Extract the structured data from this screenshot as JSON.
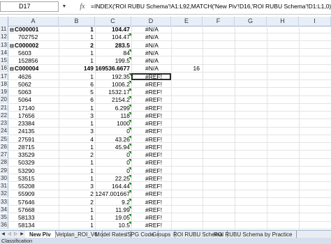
{
  "formula_bar": {
    "name_box": "D17",
    "fx_label": "fx",
    "formula": "=INDEX('ROI RUBU Schema'!A1:L92,MATCH('New Piv'!D16,'ROI RUBU Schema'!D1:L1,0))"
  },
  "columns": [
    "A",
    "B",
    "C",
    "D",
    "E",
    "F",
    "G",
    "H",
    "I"
  ],
  "rows": [
    {
      "num": "11",
      "a": "C000001",
      "b": "1",
      "c": "104.47",
      "d": "#N/A",
      "bold": true,
      "expander": true
    },
    {
      "num": "12",
      "a": "702752",
      "b": "1",
      "c": "104.47",
      "d": "#N/A"
    },
    {
      "num": "13",
      "a": "C000002",
      "b": "2",
      "c": "283.5",
      "d": "#N/A",
      "bold": true,
      "expander": true
    },
    {
      "num": "14",
      "a": "5603",
      "b": "1",
      "c": "84",
      "d": "#N/A"
    },
    {
      "num": "15",
      "a": "152856",
      "b": "1",
      "c": "199.5",
      "d": "#N/A"
    },
    {
      "num": "16",
      "a": "C000004",
      "b": "149",
      "c": "169536.6677",
      "d": "#N/A",
      "e": "16",
      "bold": true,
      "expander": true
    },
    {
      "num": "17",
      "a": "4626",
      "b": "1",
      "c": "192.35",
      "d": "#REF!",
      "selected": true
    },
    {
      "num": "18",
      "a": "5062",
      "b": "6",
      "c": "1006.2",
      "d": "#REF!"
    },
    {
      "num": "19",
      "a": "5063",
      "b": "5",
      "c": "1532.17",
      "d": "#REF!"
    },
    {
      "num": "20",
      "a": "5064",
      "b": "6",
      "c": "2154.2",
      "d": "#REF!"
    },
    {
      "num": "21",
      "a": "17140",
      "b": "1",
      "c": "6.299",
      "d": "#REF!"
    },
    {
      "num": "22",
      "a": "17656",
      "b": "3",
      "c": "118",
      "d": "#REF!"
    },
    {
      "num": "23",
      "a": "23384",
      "b": "1",
      "c": "1000",
      "d": "#REF!"
    },
    {
      "num": "24",
      "a": "24135",
      "b": "3",
      "c": "0",
      "d": "#REF!"
    },
    {
      "num": "25",
      "a": "27591",
      "b": "4",
      "c": "43.26",
      "d": "#REF!"
    },
    {
      "num": "26",
      "a": "28715",
      "b": "1",
      "c": "45.94",
      "d": "#REF!"
    },
    {
      "num": "27",
      "a": "33529",
      "b": "2",
      "c": "0",
      "d": "#REF!"
    },
    {
      "num": "28",
      "a": "50329",
      "b": "1",
      "c": "0",
      "d": "#REF!"
    },
    {
      "num": "29",
      "a": "53290",
      "b": "1",
      "c": "0",
      "d": "#REF!"
    },
    {
      "num": "30",
      "a": "53515",
      "b": "1",
      "c": "22.25",
      "d": "#REF!"
    },
    {
      "num": "31",
      "a": "55208",
      "b": "3",
      "c": "164.44",
      "d": "#REF!"
    },
    {
      "num": "32",
      "a": "55909",
      "b": "2",
      "c": "1247.001667",
      "d": "#REF!"
    },
    {
      "num": "33",
      "a": "57646",
      "b": "2",
      "c": "9.2",
      "d": "#REF!"
    },
    {
      "num": "34",
      "a": "57668",
      "b": "1",
      "c": "11.99",
      "d": "#REF!"
    },
    {
      "num": "35",
      "a": "58133",
      "b": "1",
      "c": "19.05",
      "d": "#REF!"
    },
    {
      "num": "36",
      "a": "58134",
      "b": "1",
      "c": "10.5",
      "d": "#REF!"
    }
  ],
  "sheet_tabs": [
    "New Piv",
    "Vetplan_ROI_V6",
    "Model Rates",
    "ISPG Code",
    "Groups",
    "ROI RUBU Schema",
    "ROI RUBU Schema by Practice"
  ],
  "active_tab": "New Piv",
  "status_text": "Classification"
}
